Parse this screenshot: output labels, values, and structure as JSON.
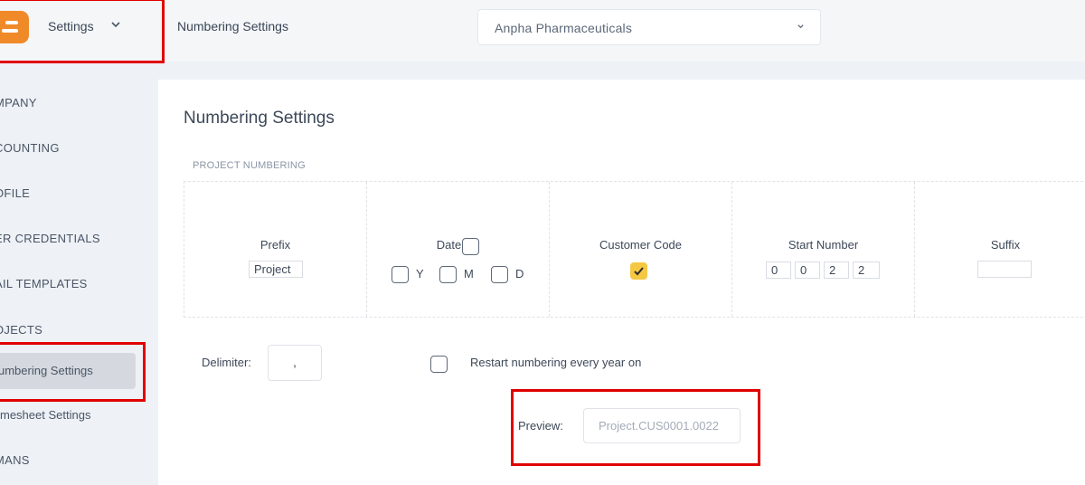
{
  "header": {
    "app_menu_label": "Settings",
    "page_title": "Numbering Settings",
    "company_select": {
      "value": "Anpha Pharmaceuticals"
    }
  },
  "sidebar": {
    "items": [
      {
        "label": "MPANY"
      },
      {
        "label": "COUNTING"
      },
      {
        "label": "OFILE"
      },
      {
        "label": "ER CREDENTIALS"
      },
      {
        "label": "AIL TEMPLATES"
      },
      {
        "label": "OJECTS"
      },
      {
        "label": "umbering Settings",
        "active": true
      },
      {
        "label": "mesheet Settings"
      },
      {
        "label": "MANS"
      }
    ]
  },
  "main": {
    "title": "Numbering Settings",
    "section_label": "PROJECT NUMBERING",
    "columns": {
      "prefix": {
        "label": "Prefix",
        "value": "Project"
      },
      "date": {
        "label": "Date",
        "checked": false,
        "options": [
          "Y",
          "M",
          "D"
        ]
      },
      "customer_code": {
        "label": "Customer Code",
        "checked": true
      },
      "start_number": {
        "label": "Start Number",
        "digits": [
          "0",
          "0",
          "2",
          "2"
        ]
      },
      "suffix": {
        "label": "Suffix",
        "value": ""
      }
    },
    "delimiter": {
      "label": "Delimiter:",
      "value": ","
    },
    "restart": {
      "label": "Restart numbering every year on",
      "checked": false
    },
    "preview": {
      "label": "Preview:",
      "value": "Project.CUS0001.0022"
    }
  },
  "colors": {
    "accent_orange": "#f08a28",
    "checkbox_checked": "#f5c842",
    "highlight_red": "#e00000"
  }
}
